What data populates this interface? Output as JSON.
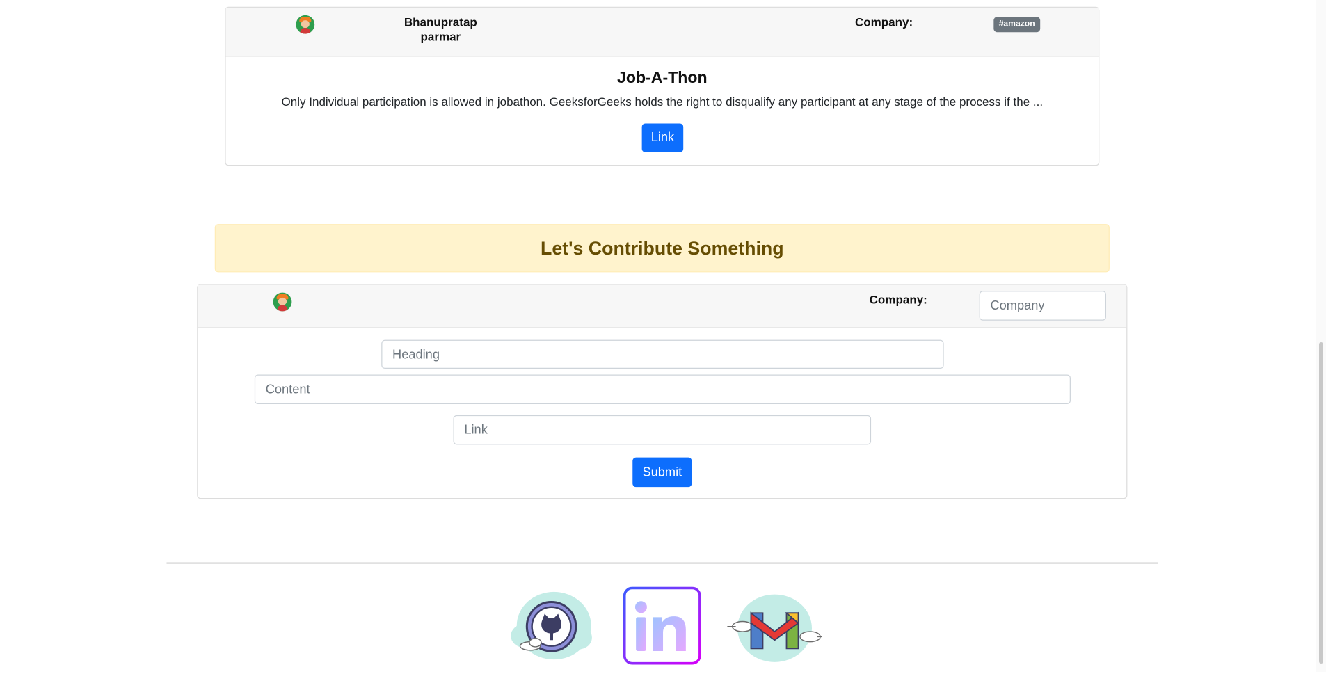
{
  "post_card": {
    "author": "Bhanupratap parmar",
    "company_label": "Company:",
    "company_tag": "#amazon",
    "title": "Job-A-Thon",
    "content": "Only Individual participation is allowed in jobathon. GeeksforGeeks holds the right to disqualify any participant at any stage of the process if the ...",
    "link_label": "Link"
  },
  "contribute": {
    "heading": "Let's Contribute Something",
    "company_label": "Company:",
    "company_placeholder": "Company",
    "heading_placeholder": "Heading",
    "content_placeholder": "Content",
    "link_placeholder": "Link",
    "submit_label": "Submit"
  },
  "footer": {
    "icons": [
      "github-icon",
      "linkedin-icon",
      "gmail-icon"
    ],
    "linkedin_text": "in"
  },
  "colors": {
    "primary": "#0d6efd",
    "alert_bg": "#fff3cd",
    "alert_text": "#664d03",
    "badge": "#6c757d"
  }
}
